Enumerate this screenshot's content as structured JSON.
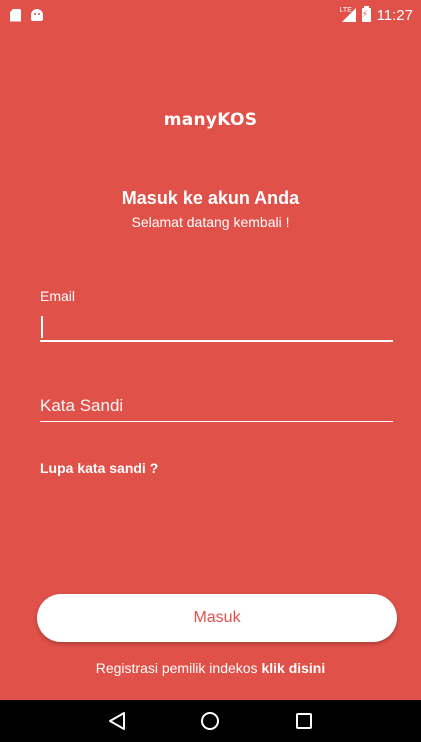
{
  "status_bar": {
    "lte_label": "LTE",
    "time": "11:27"
  },
  "app": {
    "logo_text": "manyKOS"
  },
  "login": {
    "title": "Masuk ke akun Anda",
    "subtitle": "Selamat datang kembali !",
    "email_label": "Email",
    "email_value": "",
    "password_placeholder": "Kata Sandi",
    "forgot_label": "Lupa kata sandi ?",
    "submit_label": "Masuk",
    "register_text": "Registrasi pemilik indekos",
    "register_link": "klik disini"
  },
  "colors": {
    "background": "#e0514a",
    "button_text": "#e0514a",
    "text": "#ffffff"
  },
  "nav": {
    "back_icon": "back-triangle-icon",
    "home_icon": "home-circle-icon",
    "recents_icon": "recents-square-icon"
  }
}
